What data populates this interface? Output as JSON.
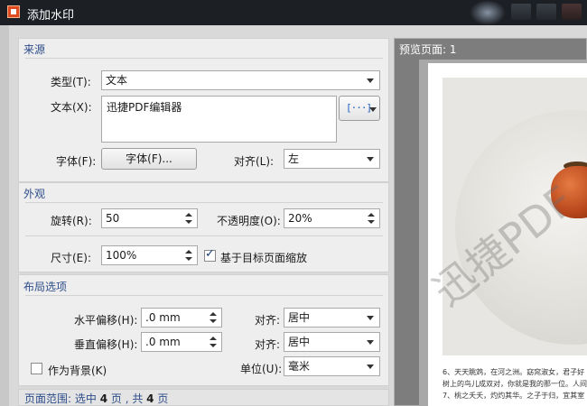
{
  "window": {
    "title": "添加水印"
  },
  "source": {
    "section_title": "来源",
    "type_label": "类型(T):",
    "type_value": "文本",
    "text_label": "文本(X):",
    "text_value": "迅捷PDF编辑器",
    "insert_button_glyph": "[···]",
    "font_label": "字体(F):",
    "font_button": "字体(F)...",
    "align_label": "对齐(L):",
    "align_value": "左"
  },
  "appearance": {
    "section_title": "外观",
    "rotation_label": "旋转(R):",
    "rotation_value": "50",
    "opacity_label": "不透明度(O):",
    "opacity_value": "20%",
    "size_label": "尺寸(E):",
    "size_value": "100%",
    "scale_checkbox_label": "基于目标页面缩放",
    "scale_checked": true
  },
  "layout": {
    "section_title": "布局选项",
    "h_offset_label": "水平偏移(H):",
    "h_offset_value": ".0 mm",
    "h_align_label": "对齐:",
    "h_align_value": "居中",
    "v_offset_label": "垂直偏移(H):",
    "v_offset_value": ".0 mm",
    "v_align_label": "对齐:",
    "v_align_value": "居中",
    "background_label": "作为背景(K)",
    "background_checked": false,
    "unit_label": "单位(U):",
    "unit_value": "毫米"
  },
  "page_range": {
    "prefix": "页面范围: 选中",
    "selected": "4",
    "middle": "页 , 共",
    "total": "4",
    "suffix": "页"
  },
  "preview": {
    "title": "预览页面: 1",
    "watermark_text": "迅捷PDF",
    "page_text_lines": [
      "6、天天眺鸩，在河之洲。窈窕淑女，君子好",
      "树上的鸟儿成双对，你就是我的那一位。人间",
      "7、桃之夭夭，灼灼其华。之子于归，宜其室"
    ]
  }
}
